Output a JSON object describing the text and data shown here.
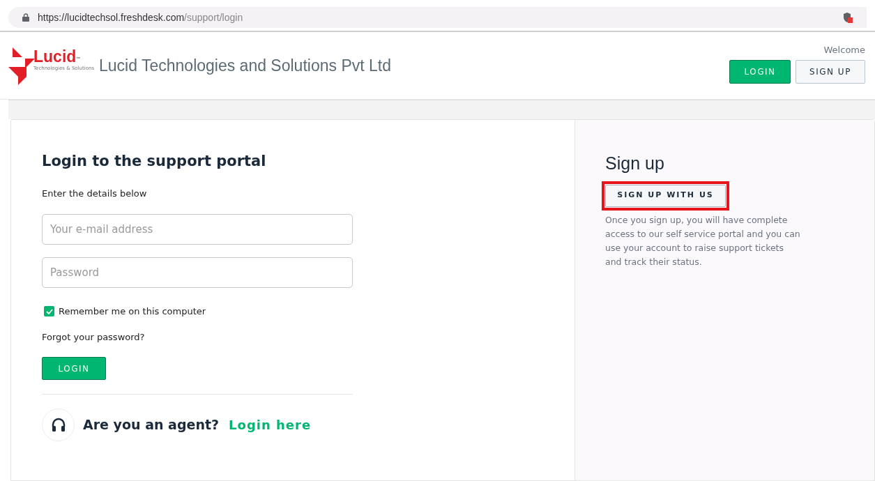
{
  "address_bar": {
    "host": "https://lucidtechsol.freshdesk.com",
    "path": "/support/login"
  },
  "header": {
    "logo_word": "Lucid",
    "logo_tm": "™",
    "logo_tagline": "Technologies & Solutions",
    "company": "Lucid Technologies and Solutions Pvt Ltd",
    "welcome": "Welcome",
    "buttons": [
      {
        "label": "LOGIN",
        "kind": "primary"
      },
      {
        "label": "SIGN UP",
        "kind": "secondary"
      }
    ]
  },
  "login": {
    "title": "Login to the support portal",
    "subtitle": "Enter the details below",
    "email": {
      "placeholder": "Your e-mail address"
    },
    "password": {
      "placeholder": "Password"
    },
    "remember": {
      "label": "Remember me on this computer",
      "checked": true
    },
    "forgot": "Forgot your password?",
    "button": "LOGIN",
    "agent_question": "Are you an agent?",
    "agent_link": "Login here"
  },
  "signup": {
    "title": "Sign up",
    "button": "SIGN UP WITH US",
    "highlighted": true,
    "description": "Once you sign up, you will have complete access to our self service portal and you can use your account to raise support tickets and track their status."
  }
}
